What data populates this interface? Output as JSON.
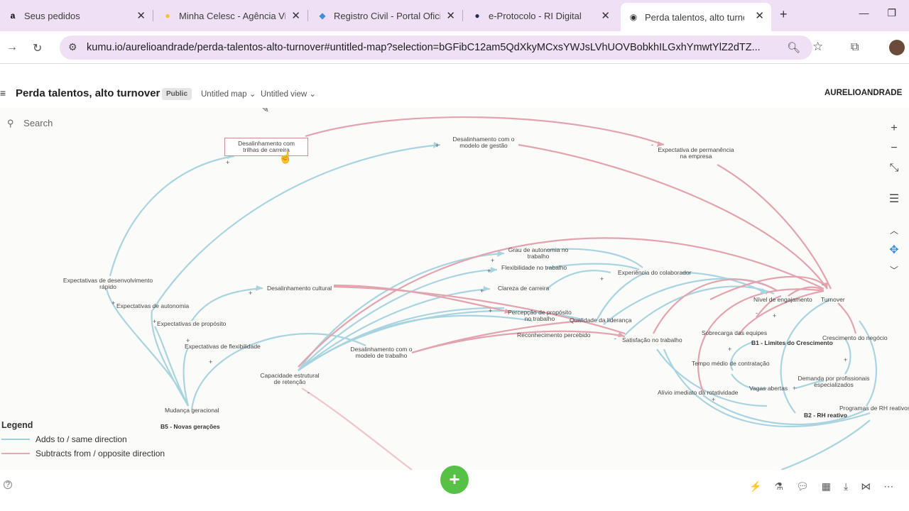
{
  "browser": {
    "tabs": [
      {
        "title": "Seus pedidos",
        "icon": "amazon-icon",
        "glyph": "a"
      },
      {
        "title": "Minha Celesc - Agência Virtual",
        "icon": "celesc-icon",
        "glyph": "●"
      },
      {
        "title": "Registro Civil - Portal Oficial",
        "icon": "registro-icon",
        "glyph": "◆"
      },
      {
        "title": "e-Protocolo - RI Digital",
        "icon": "protocolo-icon",
        "glyph": "●"
      },
      {
        "title": "Perda talentos, alto turnover",
        "icon": "kumu-icon",
        "glyph": "◉"
      }
    ],
    "url": "kumu.io/aurelioandrade/perda-talentos-alto-turnover#untitled-map?selection=bGFibC12am5QdXkyMCxsYWJsLVhUOVBobkhILGxhYmwtYlZ2dTZ...",
    "new_tab": "+"
  },
  "kumu": {
    "project_title": "Perda talentos, alto turnover",
    "visibility_badge": "Public",
    "map_selector": "Untitled map ⌄",
    "view_selector": "Untitled view ⌄",
    "user": "AURELIOANDRADE",
    "search_placeholder": "Search",
    "add_button": "+"
  },
  "nodes": [
    {
      "id": "n1",
      "label": "Desalinhamento com trilhas de carreira"
    },
    {
      "id": "n2",
      "label": "Desalinhamento com o modelo de gestão"
    },
    {
      "id": "n3",
      "label": "Expectativa de permanência na empresa"
    },
    {
      "id": "n4",
      "label": "Expectativas de desenvolvimento rápido"
    },
    {
      "id": "n5",
      "label": "Expectativas de autonomia"
    },
    {
      "id": "n6",
      "label": "Expectativas de propósito"
    },
    {
      "id": "n7",
      "label": "Expectativas de flexibilidade"
    },
    {
      "id": "n8",
      "label": "Mudança geracional"
    },
    {
      "id": "n9",
      "label": "B5 - Novas gerações"
    },
    {
      "id": "n10",
      "label": "Desalinhamento cultural"
    },
    {
      "id": "n11",
      "label": "Capacidade estrutural de retenção"
    },
    {
      "id": "n12",
      "label": "Desalinhamento com o modelo de trabalho"
    },
    {
      "id": "n13",
      "label": "Grau de autonomia no trabalho"
    },
    {
      "id": "n14",
      "label": "Flexibilidade no trabalho"
    },
    {
      "id": "n15",
      "label": "Clareza de carreira"
    },
    {
      "id": "n16",
      "label": "Percepção de propósito no trabalho"
    },
    {
      "id": "n17",
      "label": "Reconhecimento percebido"
    },
    {
      "id": "n18",
      "label": "Experiência do colaborador"
    },
    {
      "id": "n19",
      "label": "Qualidade da liderança"
    },
    {
      "id": "n20",
      "label": "Satisfação no trabalho"
    },
    {
      "id": "n21",
      "label": "Nível de engajamento"
    },
    {
      "id": "n22",
      "label": "Turnover"
    },
    {
      "id": "n23",
      "label": "Sobrecarga das equipes"
    },
    {
      "id": "n24",
      "label": "B1 - Limites do Crescimento"
    },
    {
      "id": "n25",
      "label": "Crescimento do negócio"
    },
    {
      "id": "n26",
      "label": "Tempo médio de contratação"
    },
    {
      "id": "n27",
      "label": "Demanda por profissionais especializados"
    },
    {
      "id": "n28",
      "label": "Vagas abertas"
    },
    {
      "id": "n29",
      "label": "Alívio imediato da rotatividade"
    },
    {
      "id": "n30",
      "label": "B2 - RH reativo"
    },
    {
      "id": "n31",
      "label": "Programas de RH reativos"
    }
  ],
  "legend": {
    "title": "Legend",
    "items": [
      {
        "label": "Adds to / same direction",
        "color": "#9fcfdc"
      },
      {
        "label": "Subtracts from / opposite direction",
        "color": "#e6a9b3"
      }
    ]
  },
  "colors": {
    "positive": "#a9d4df",
    "negative": "#e3a3ae",
    "add_button": "#57c145"
  }
}
